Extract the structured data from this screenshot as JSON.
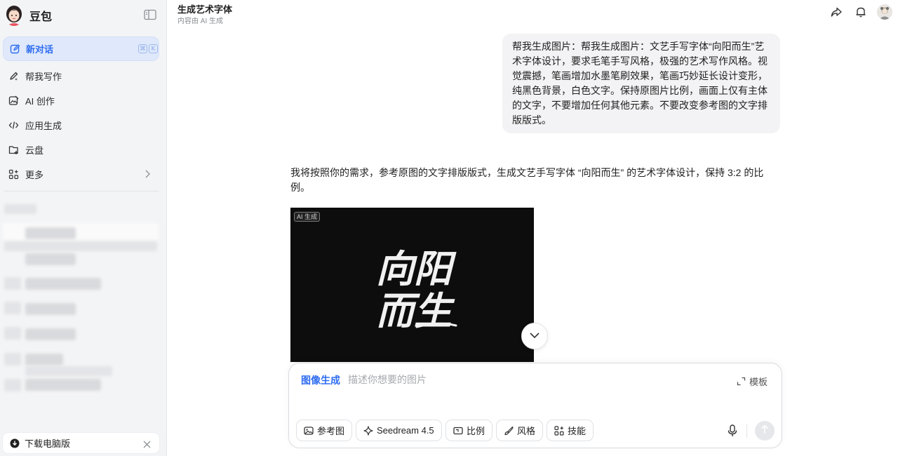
{
  "app": {
    "name": "豆包"
  },
  "sidebar": {
    "new_chat": "新对话",
    "shortcut_keys": [
      "⌘",
      "K"
    ],
    "items": [
      {
        "label": "帮我写作",
        "icon": "pen-sparkle-icon"
      },
      {
        "label": "AI 创作",
        "icon": "image-edit-icon"
      },
      {
        "label": "应用生成",
        "icon": "code-icon"
      },
      {
        "label": "云盘",
        "icon": "cloud-folder-icon"
      },
      {
        "label": "更多",
        "icon": "grid-plus-icon"
      }
    ],
    "download": "下载电脑版"
  },
  "header": {
    "title": "生成艺术字体",
    "subtitle": "内容由 AI 生成"
  },
  "conversation": {
    "user_message": "帮我生成图片：帮我生成图片：文艺手写字体“向阳而生”艺术字体设计，要求毛笔手写风格，极强的艺术写作风格。视觉震撼，笔画增加水墨笔刷效果，笔画巧妙延长设计变形，纯黑色背景，白色文字。保持原图片比例，画面上仅有主体的文字，不要增加任何其他元素。不要改变参考图的文字排版版式。",
    "assistant_message": "我将按照你的需求，参考原图的文字排版版式，生成文艺手写字体 “向阳而生” 的艺术字体设计，保持 3:2 的比例。",
    "image": {
      "tag": "AI 生成",
      "text_line1": "向阳",
      "text_line2": "而生"
    }
  },
  "composer": {
    "mode": "图像生成",
    "placeholder": "描述你想要的图片",
    "template": "模板",
    "tools": [
      {
        "label": "参考图",
        "icon": "image-icon"
      },
      {
        "label": "Seedream 4.5",
        "icon": "sparkle-icon"
      },
      {
        "label": "比例",
        "icon": "ratio-icon"
      },
      {
        "label": "风格",
        "icon": "brush-icon"
      },
      {
        "label": "技能",
        "icon": "apps-icon"
      }
    ]
  },
  "colors": {
    "accent": "#2f6df0",
    "sidebar_bg": "#f3f4f6",
    "new_chat_bg": "#dfe9fb",
    "bubble_bg": "#f3f3f5",
    "image_bg": "#0d0d0d"
  }
}
